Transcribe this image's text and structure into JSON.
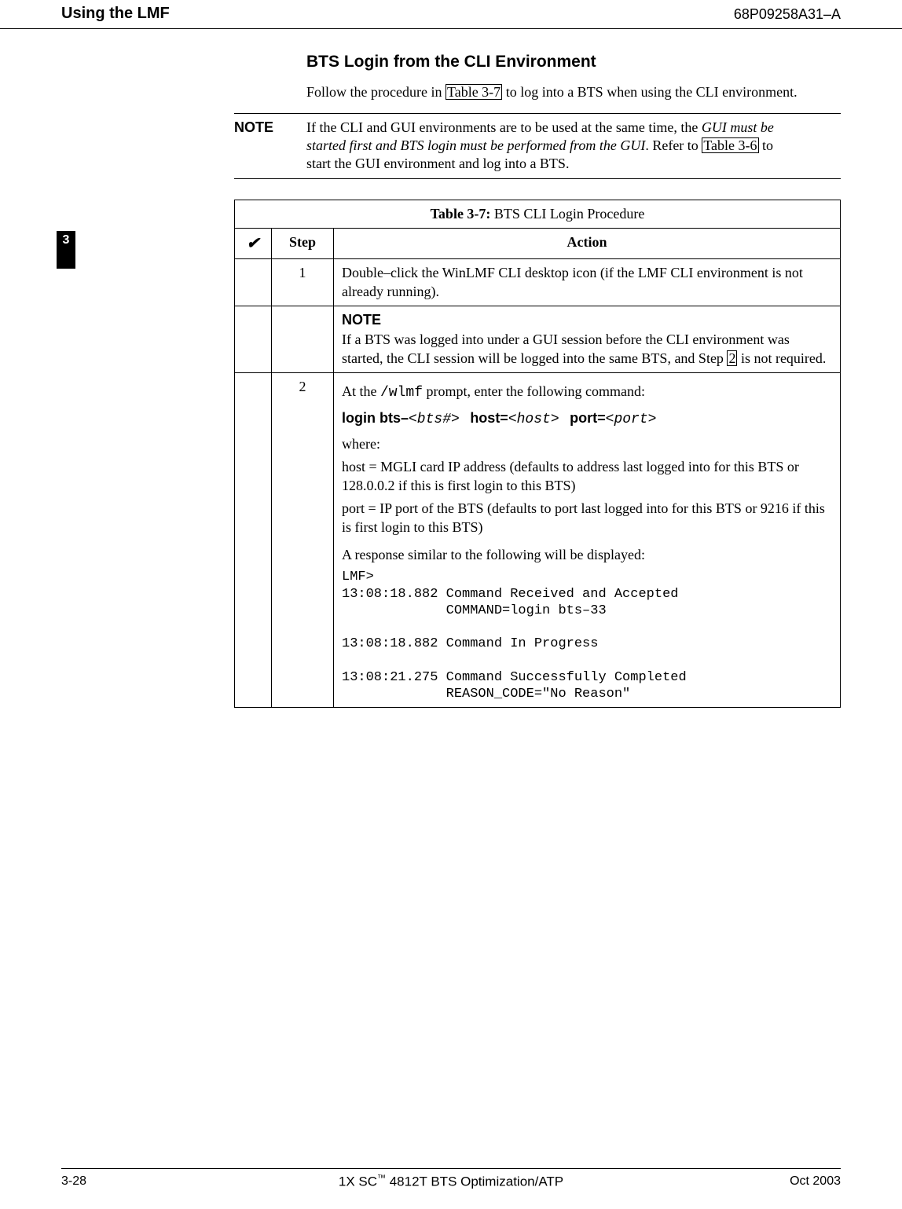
{
  "header": {
    "left": "Using the LMF",
    "right": "68P09258A31–A"
  },
  "heading": "BTS Login from the CLI Environment",
  "intro": {
    "pre": "Follow the procedure in ",
    "link": "Table 3-7",
    "post": " to log into a BTS when using the CLI environment."
  },
  "note": {
    "label": "NOTE",
    "line1": "If the CLI and GUI environments are to be used at the same time, the ",
    "italic": "GUI must be started first and BTS login must be performed from the GUI",
    "mid": ". Refer to ",
    "link": "Table 3-6",
    "post": " to start the GUI environment and log into a BTS."
  },
  "sideTab": "3",
  "table": {
    "caption_num": "Table 3-7:",
    "caption_text": " BTS CLI Login Procedure",
    "check": "✔",
    "step_head": "Step",
    "action_head": "Action",
    "rows": {
      "r1": {
        "step": "1",
        "action": "Double–click the WinLMF CLI desktop icon (if the LMF CLI environment is not already running)."
      },
      "rnote": {
        "head": "NOTE",
        "body_pre": "If a BTS was logged into under a GUI session before the CLI environment was started, the CLI session will be logged into the same BTS, and Step ",
        "link": "2",
        "body_post": " is not required."
      },
      "r2": {
        "step": "2",
        "line1_pre": "At the ",
        "line1_mono": "/wlmf",
        "line1_post": " prompt, enter the following command:",
        "cmd_login": "login bts–",
        "cmd_bts_it": "<bts#>",
        "cmd_host_lbl": "host=",
        "cmd_host_it": "<host>",
        "cmd_port_lbl": "port=",
        "cmd_port_it": "<port>",
        "where": "where:",
        "host_expl": "host = MGLI card IP address (defaults to address last logged into for this BTS or 128.0.0.2 if this is first login to this BTS)",
        "port_expl": "port = IP port of the BTS (defaults to port last logged into for this BTS or 9216 if this is first login to this BTS)",
        "resp_intro": "A response similar to the following will be displayed:",
        "response": "LMF>\n13:08:18.882 Command Received and Accepted\n             COMMAND=login bts–33\n\n13:08:18.882 Command In Progress\n\n13:08:21.275 Command Successfully Completed\n             REASON_CODE=\"No Reason\""
      }
    }
  },
  "footer": {
    "left": "3-28",
    "center_pre": "1X SC",
    "center_tm": "™",
    "center_post": " 4812T BTS Optimization/ATP",
    "right": "Oct 2003"
  }
}
